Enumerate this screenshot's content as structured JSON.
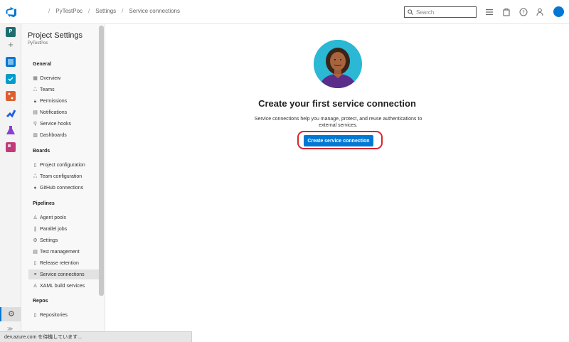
{
  "breadcrumbs": [
    "PyTestPoc",
    "Settings",
    "Service connections"
  ],
  "search": {
    "placeholder": "Search"
  },
  "rail": {
    "project_initial": "P"
  },
  "nav": {
    "title": "Project Settings",
    "project": "PyTestPoc",
    "sections": [
      {
        "label": "General",
        "items": [
          {
            "label": "Overview",
            "icon": "overview-icon"
          },
          {
            "label": "Teams",
            "icon": "teams-icon"
          },
          {
            "label": "Permissions",
            "icon": "lock-icon"
          },
          {
            "label": "Notifications",
            "icon": "notification-icon"
          },
          {
            "label": "Service hooks",
            "icon": "hook-icon"
          },
          {
            "label": "Dashboards",
            "icon": "dashboard-icon"
          }
        ]
      },
      {
        "label": "Boards",
        "items": [
          {
            "label": "Project configuration",
            "icon": "document-icon"
          },
          {
            "label": "Team configuration",
            "icon": "team-config-icon"
          },
          {
            "label": "GitHub connections",
            "icon": "github-icon"
          }
        ]
      },
      {
        "label": "Pipelines",
        "items": [
          {
            "label": "Agent pools",
            "icon": "agent-icon"
          },
          {
            "label": "Parallel jobs",
            "icon": "parallel-icon"
          },
          {
            "label": "Settings",
            "icon": "gear-icon"
          },
          {
            "label": "Test management",
            "icon": "test-icon"
          },
          {
            "label": "Release retention",
            "icon": "phone-icon"
          },
          {
            "label": "Service connections",
            "icon": "link-icon",
            "active": true
          },
          {
            "label": "XAML build services",
            "icon": "build-icon"
          }
        ]
      },
      {
        "label": "Repos",
        "items": [
          {
            "label": "Repositories",
            "icon": "repo-icon"
          }
        ]
      }
    ]
  },
  "main": {
    "heading": "Create your first service connection",
    "description": "Service connections help you manage, protect, and reuse authentications to external services.",
    "button_label": "Create service connection"
  },
  "status_bar": "dev.azure.com を待機しています...",
  "colors": {
    "accent": "#0078d4",
    "highlight_ring": "#d6262b",
    "hero_bg": "#2ab8d4"
  }
}
